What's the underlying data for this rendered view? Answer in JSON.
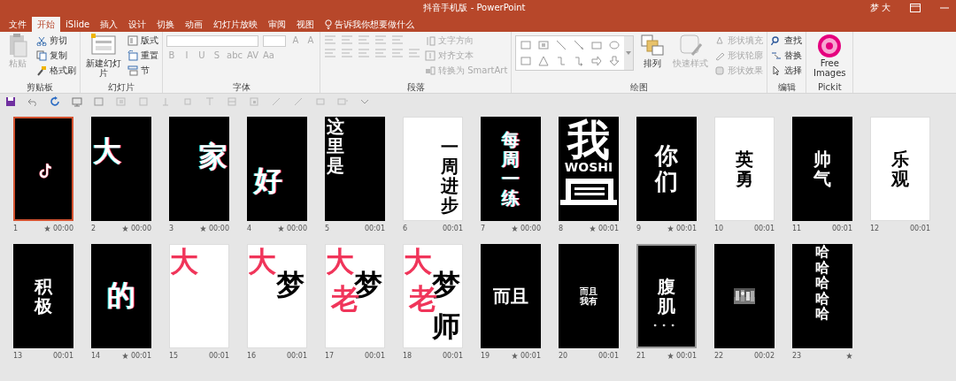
{
  "title_bar": {
    "title": "抖音手机版 - PowerPoint",
    "user": "梦 大"
  },
  "tabs": [
    {
      "label": "文件",
      "selected": false
    },
    {
      "label": "开始",
      "selected": true
    },
    {
      "label": "iSlide",
      "selected": false
    },
    {
      "label": "插入",
      "selected": false
    },
    {
      "label": "设计",
      "selected": false
    },
    {
      "label": "切换",
      "selected": false
    },
    {
      "label": "动画",
      "selected": false
    },
    {
      "label": "幻灯片放映",
      "selected": false
    },
    {
      "label": "审阅",
      "selected": false
    },
    {
      "label": "视图",
      "selected": false
    }
  ],
  "tell_me": "告诉我你想要做什么",
  "ribbon_groups": [
    {
      "label": "剪贴板",
      "items": [
        {
          "kind": "large",
          "label": "粘贴",
          "disabled": true
        },
        {
          "kind": "stack",
          "rows": [
            [
              {
                "kind": "small",
                "label": "剪切",
                "disabled": false
              }
            ],
            [
              {
                "kind": "small",
                "label": "复制",
                "disabled": false
              }
            ],
            [
              {
                "kind": "small",
                "label": "格式刷",
                "disabled": false
              }
            ]
          ]
        }
      ]
    },
    {
      "label": "幻灯片",
      "items": [
        {
          "kind": "large",
          "label": "新建幻灯片",
          "disabled": false
        },
        {
          "kind": "stack",
          "rows": [
            [
              {
                "kind": "small",
                "label": "版式",
                "disabled": false
              }
            ],
            [
              {
                "kind": "small",
                "label": "重置",
                "disabled": false
              }
            ],
            [
              {
                "kind": "small",
                "label": "节",
                "disabled": false
              }
            ]
          ]
        }
      ]
    },
    {
      "label": "字体",
      "items": [
        {
          "kind": "stack",
          "rows": [
            [
              {
                "kind": "fontfield"
              },
              {
                "kind": "sizefield"
              },
              {
                "kind": "glyph",
                "label": "A",
                "disabled": true
              },
              {
                "kind": "glyph",
                "label": "A",
                "disabled": true
              }
            ],
            [
              {
                "kind": "glyph",
                "label": "B",
                "disabled": true
              },
              {
                "kind": "glyph",
                "label": "I",
                "disabled": true
              },
              {
                "kind": "glyph",
                "label": "U",
                "disabled": true
              },
              {
                "kind": "glyph",
                "label": "S",
                "disabled": true
              },
              {
                "kind": "glyph",
                "label": "abc",
                "disabled": true
              },
              {
                "kind": "glyph",
                "label": "AV",
                "disabled": true
              },
              {
                "kind": "glyph",
                "label": "Aa",
                "disabled": true
              }
            ]
          ]
        }
      ]
    },
    {
      "label": "段落",
      "items": [
        {
          "kind": "stack",
          "rows": [
            [
              {
                "kind": "icon",
                "disabled": true
              },
              {
                "kind": "icon",
                "disabled": true
              },
              {
                "kind": "icon",
                "disabled": true
              },
              {
                "kind": "icon",
                "disabled": true
              },
              {
                "kind": "icon",
                "disabled": true
              }
            ],
            [
              {
                "kind": "icon",
                "disabled": true
              },
              {
                "kind": "icon",
                "disabled": true
              },
              {
                "kind": "icon",
                "disabled": true
              },
              {
                "kind": "icon",
                "disabled": true
              },
              {
                "kind": "icon",
                "disabled": true
              },
              {
                "kind": "icon",
                "disabled": true
              }
            ]
          ]
        },
        {
          "kind": "stack",
          "rows": [
            [
              {
                "kind": "small",
                "label": "文字方向",
                "disabled": true
              }
            ],
            [
              {
                "kind": "small",
                "label": "对齐文本",
                "disabled": true
              }
            ],
            [
              {
                "kind": "small",
                "label": "转换为 SmartArt",
                "disabled": true
              }
            ]
          ]
        }
      ]
    },
    {
      "label": "绘图",
      "items": [
        {
          "kind": "gallery"
        },
        {
          "kind": "large",
          "label": "排列",
          "disabled": false
        },
        {
          "kind": "large",
          "label": "快速样式",
          "disabled": true
        },
        {
          "kind": "stack",
          "rows": [
            [
              {
                "kind": "small",
                "label": "形状填充",
                "disabled": true
              }
            ],
            [
              {
                "kind": "small",
                "label": "形状轮廓",
                "disabled": true
              }
            ],
            [
              {
                "kind": "small",
                "label": "形状效果",
                "disabled": true
              }
            ]
          ]
        }
      ]
    },
    {
      "label": "编辑",
      "items": [
        {
          "kind": "stack",
          "rows": [
            [
              {
                "kind": "small",
                "label": "查找",
                "disabled": false
              }
            ],
            [
              {
                "kind": "small",
                "label": "替换",
                "disabled": false
              }
            ],
            [
              {
                "kind": "small",
                "label": "选择",
                "disabled": false
              }
            ]
          ]
        }
      ]
    },
    {
      "label": "Pickit",
      "items": [
        {
          "kind": "large",
          "label": "Free Images",
          "disabled": false
        }
      ]
    }
  ],
  "slides": [
    {
      "number": "1",
      "kind": "logo",
      "dark": true,
      "selected": true,
      "hovered": false,
      "animated": true,
      "time": "00:00"
    },
    {
      "number": "2",
      "kind": "plain",
      "dark": true,
      "selected": false,
      "hovered": false,
      "animated": true,
      "time": "00:00",
      "texts": [
        {
          "text": "大",
          "kind": "left",
          "glitch": true
        }
      ]
    },
    {
      "number": "3",
      "kind": "plain",
      "dark": true,
      "selected": false,
      "hovered": false,
      "animated": true,
      "time": "00:00",
      "texts": [
        {
          "text": "家",
          "kind": "right",
          "glitch": true
        }
      ]
    },
    {
      "number": "4",
      "kind": "plain",
      "dark": true,
      "selected": false,
      "hovered": false,
      "animated": true,
      "time": "00:00",
      "texts": [
        {
          "text": "好",
          "kind": "low",
          "glitch": true
        }
      ]
    },
    {
      "number": "5",
      "kind": "plain",
      "dark": true,
      "selected": false,
      "hovered": false,
      "animated": false,
      "time": "00:01",
      "texts": [
        {
          "text": "这里是",
          "kind": "edge"
        }
      ]
    },
    {
      "number": "6",
      "kind": "plain",
      "dark": false,
      "selected": false,
      "hovered": false,
      "animated": false,
      "time": "00:01",
      "texts": [
        {
          "text": "一周进步",
          "kind": "side"
        }
      ]
    },
    {
      "number": "7",
      "kind": "plain",
      "dark": true,
      "selected": false,
      "hovered": false,
      "animated": true,
      "time": "00:00",
      "texts": [
        {
          "text": "每周一练",
          "kind": "column",
          "glitch": true
        }
      ]
    },
    {
      "number": "8",
      "kind": "poster",
      "dark": true,
      "selected": false,
      "hovered": false,
      "animated": true,
      "time": "00:01",
      "texts": [
        {
          "text": "我",
          "kind": "banner"
        },
        {
          "text": "WOSHI",
          "kind": "latin"
        }
      ]
    },
    {
      "number": "9",
      "kind": "plain",
      "dark": true,
      "selected": false,
      "hovered": false,
      "animated": true,
      "time": "00:01",
      "texts": [
        {
          "text": "你们",
          "kind": "pillar"
        }
      ]
    },
    {
      "number": "10",
      "kind": "plain",
      "dark": false,
      "selected": false,
      "hovered": false,
      "animated": false,
      "time": "00:01",
      "texts": [
        {
          "text": "英勇",
          "kind": "column"
        }
      ]
    },
    {
      "number": "11",
      "kind": "plain",
      "dark": true,
      "selected": false,
      "hovered": false,
      "animated": false,
      "time": "00:01",
      "texts": [
        {
          "text": "帅气",
          "kind": "column"
        }
      ]
    },
    {
      "number": "12",
      "kind": "plain",
      "dark": false,
      "selected": false,
      "hovered": false,
      "animated": false,
      "time": "00:01",
      "texts": [
        {
          "text": "乐观",
          "kind": "column"
        }
      ]
    },
    {
      "number": "13",
      "kind": "plain",
      "dark": true,
      "selected": false,
      "hovered": false,
      "animated": false,
      "time": "00:01",
      "texts": [
        {
          "text": "积极",
          "kind": "column"
        }
      ]
    },
    {
      "number": "14",
      "kind": "plain",
      "dark": true,
      "selected": false,
      "hovered": false,
      "animated": true,
      "time": "00:01",
      "texts": [
        {
          "text": "的",
          "kind": "center",
          "glitch": true
        }
      ]
    },
    {
      "number": "15",
      "kind": "plain",
      "dark": false,
      "selected": false,
      "hovered": false,
      "animated": false,
      "time": "00:01",
      "texts": [
        {
          "text": "大",
          "kind": "corner",
          "color": "#f0355a"
        }
      ]
    },
    {
      "number": "16",
      "kind": "plain",
      "dark": false,
      "selected": false,
      "hovered": false,
      "animated": false,
      "time": "00:01",
      "texts": [
        {
          "text": "大",
          "kind": "corner",
          "color": "#f0355a"
        },
        {
          "text": "梦",
          "kind": "right"
        }
      ]
    },
    {
      "number": "17",
      "kind": "plain",
      "dark": false,
      "selected": false,
      "hovered": false,
      "animated": false,
      "time": "00:01",
      "texts": [
        {
          "text": "大",
          "kind": "corner",
          "color": "#f0355a"
        },
        {
          "text": "梦",
          "kind": "right"
        },
        {
          "text": "老",
          "kind": "middle",
          "color": "#f0355a"
        }
      ]
    },
    {
      "number": "18",
      "kind": "plain",
      "dark": false,
      "selected": false,
      "hovered": false,
      "animated": false,
      "time": "00:01",
      "texts": [
        {
          "text": "大",
          "kind": "corner",
          "color": "#f0355a"
        },
        {
          "text": "梦",
          "kind": "right"
        },
        {
          "text": "老",
          "kind": "middle",
          "color": "#f0355a"
        },
        {
          "text": "师",
          "kind": "foot"
        }
      ]
    },
    {
      "number": "19",
      "kind": "plain",
      "dark": true,
      "selected": false,
      "hovered": false,
      "animated": true,
      "time": "00:01",
      "texts": [
        {
          "text": "而且",
          "kind": "heading"
        }
      ]
    },
    {
      "number": "20",
      "kind": "plain",
      "dark": true,
      "selected": false,
      "hovered": false,
      "animated": false,
      "time": "00:01",
      "texts": [
        {
          "text": "而且我有",
          "kind": "caption"
        }
      ]
    },
    {
      "number": "21",
      "kind": "plain",
      "dark": true,
      "selected": false,
      "hovered": true,
      "animated": true,
      "time": "00:01",
      "texts": [
        {
          "text": "腹肌",
          "kind": "column"
        },
        {
          "text": "。。。",
          "kind": "dots"
        }
      ]
    },
    {
      "number": "22",
      "dark": true,
      "selected": false,
      "hovered": false,
      "animated": false,
      "time": "00:02"
    },
    {
      "number": "23",
      "kind": "plain",
      "dark": true,
      "selected": false,
      "hovered": false,
      "animated": true,
      "texts": [
        {
          "text": "哈哈哈哈哈",
          "kind": "tower"
        }
      ]
    }
  ]
}
